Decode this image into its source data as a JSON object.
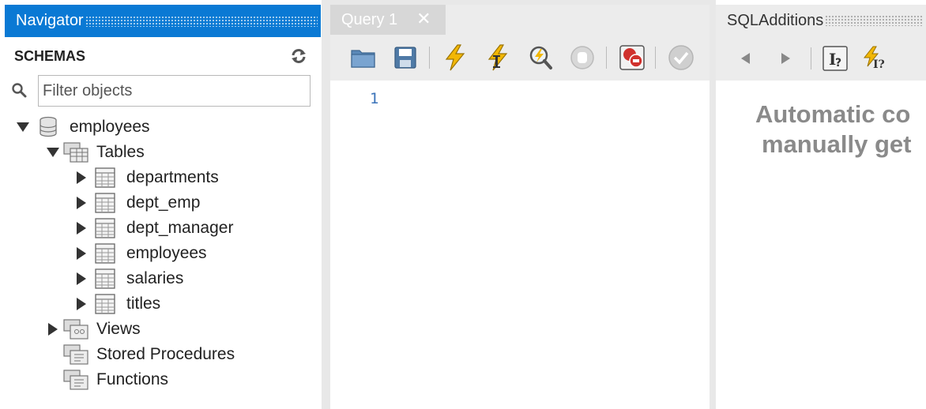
{
  "navigator": {
    "title": "Navigator",
    "schemas_label": "SCHEMAS",
    "filter_placeholder": "Filter objects",
    "schema": {
      "name": "employees",
      "tables_label": "Tables",
      "tables": [
        "departments",
        "dept_emp",
        "dept_manager",
        "employees",
        "salaries",
        "titles"
      ],
      "views_label": "Views",
      "procedures_label": "Stored Procedures",
      "functions_label": "Functions"
    }
  },
  "query": {
    "tab_label": "Query 1",
    "line_number": "1"
  },
  "sql_additions": {
    "title": "SQLAdditions",
    "message_line1": "Automatic co",
    "message_line2": "manually get"
  },
  "colors": {
    "accent": "#0a79d4",
    "lightning": "#f2b705",
    "stop_red": "#d0312d"
  }
}
